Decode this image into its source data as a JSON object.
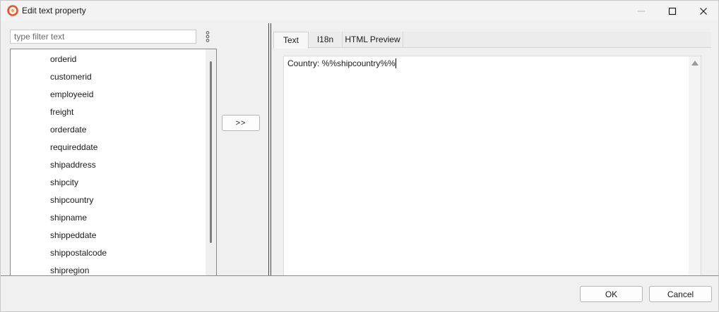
{
  "window": {
    "title": "Edit text property",
    "app_icon": "report-designer-logo-icon",
    "accent_color": "#e8552b",
    "controls": [
      "minimize-icon",
      "maximize-icon",
      "close-icon"
    ]
  },
  "left_panel": {
    "filter": {
      "placeholder": "type filter text",
      "value": ""
    },
    "menu_icon": "vertical-dots-icon",
    "fields": [
      "orderid",
      "customerid",
      "employeeid",
      "freight",
      "orderdate",
      "requireddate",
      "shipaddress",
      "shipcity",
      "shipcountry",
      "shipname",
      "shippeddate",
      "shippostalcode",
      "shipregion"
    ]
  },
  "insert_button": {
    "label": ">>"
  },
  "tabs": [
    {
      "label": "Text",
      "active": true
    },
    {
      "label": "I18n",
      "active": false
    },
    {
      "label": "HTML Preview",
      "active": false
    }
  ],
  "editor": {
    "content": "Country: %%shipcountry%%"
  },
  "footer": {
    "ok_label": "OK",
    "cancel_label": "Cancel"
  }
}
